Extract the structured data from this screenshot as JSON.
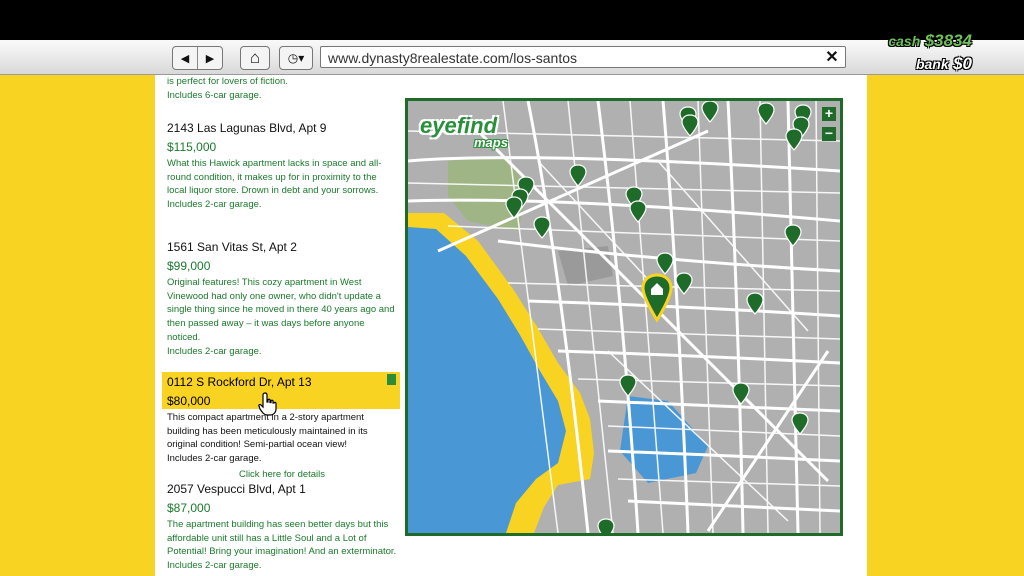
{
  "browser": {
    "url": "www.dynasty8realestate.com/los-santos",
    "back_icon": "◀",
    "forward_icon": "▶",
    "home_icon": "⌂",
    "history_icon": "◷▾",
    "close_icon": "✕"
  },
  "hud": {
    "cash_label": "cash",
    "cash_value": "$3834",
    "bank_label": "bank",
    "bank_value": "$0"
  },
  "fragment": {
    "line1": "is perfect for lovers of fiction.",
    "line2": "Includes 6-car garage."
  },
  "listings": [
    {
      "address": "2143 Las Lagunas Blvd, Apt 9",
      "price": "$115,000",
      "description": "What this Hawick apartment lacks in space and all-round condition, it makes up for in proximity to the local liquor store. Drown in debt and your sorrows.",
      "garage": "Includes 2-car garage."
    },
    {
      "address": "1561 San Vitas St, Apt 2",
      "price": "$99,000",
      "description": "Original features! This cozy apartment in West Vinewood had only one owner, who didn't update a single thing since he moved in there 40 years ago and then passed away – it was days before anyone noticed.",
      "garage": "Includes 2-car garage."
    },
    {
      "address": "0112 S Rockford Dr, Apt 13",
      "price": "$80,000",
      "description": "This compact apartment in a 2-story apartment building has been meticulously maintained in its original condition! Semi-partial ocean view!",
      "garage": "Includes 2-car garage.",
      "details_link": "Click here for details"
    },
    {
      "address": "2057 Vespucci Blvd, Apt 1",
      "price": "$87,000",
      "description": "The apartment building has seen better days but this affordable unit still has a Little Soul and a Lot of Potential! Bring your imagination! And an exterminator.",
      "garage": "Includes 2-car garage."
    }
  ],
  "map": {
    "logo_word1": "eyefind",
    "logo_word2": "maps",
    "zoom_in": "+",
    "zoom_out": "−",
    "colors": {
      "water": "#4a97d5",
      "beach": "#f8d322",
      "land": "#b0b0b0",
      "road": "#ffffff",
      "park": "#9fb585",
      "marker": "#1e6b2a",
      "selected_marker": "#f8d322"
    }
  },
  "colors": {
    "background": "#f8d322",
    "text_green": "#1b7a2c",
    "map_border": "#1e6b2a"
  }
}
